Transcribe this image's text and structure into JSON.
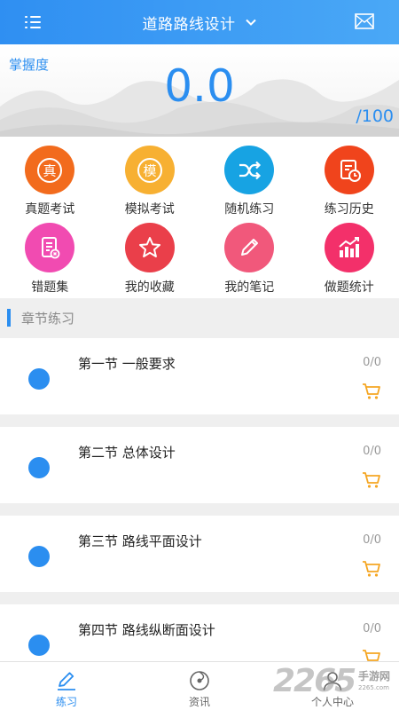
{
  "header": {
    "title": "道路路线设计",
    "menu_icon": "list-menu-icon",
    "mail_icon": "mail-icon",
    "bg": "#3b9bf4"
  },
  "mastery": {
    "label": "掌握度",
    "score": "0.0",
    "total": "/100"
  },
  "features": [
    {
      "label": "真题考试",
      "glyph": "真",
      "color": "#f26b1d",
      "icon": "real-exam-icon"
    },
    {
      "label": "模拟考试",
      "glyph": "模",
      "color": "#f7b032",
      "icon": "mock-exam-icon"
    },
    {
      "label": "随机练习",
      "color": "#17a3e3",
      "icon": "shuffle-icon"
    },
    {
      "label": "练习历史",
      "color": "#f0441c",
      "icon": "history-icon"
    },
    {
      "label": "错题集",
      "color": "#f14bb1",
      "icon": "wrong-questions-icon"
    },
    {
      "label": "我的收藏",
      "color": "#ea3f4a",
      "icon": "star-icon"
    },
    {
      "label": "我的笔记",
      "color": "#f1587b",
      "icon": "pencil-icon"
    },
    {
      "label": "做题统计",
      "color": "#f3306a",
      "icon": "stats-chart-icon"
    }
  ],
  "section": {
    "title": "章节练习"
  },
  "chapters": [
    {
      "name": "第一节 一般要求",
      "count": "0/0"
    },
    {
      "name": "第二节 总体设计",
      "count": "0/0"
    },
    {
      "name": "第三节 路线平面设计",
      "count": "0/0"
    },
    {
      "name": "第四节 路线纵断面设计",
      "count": "0/0"
    }
  ],
  "nav": [
    {
      "label": "练习",
      "icon": "practice-pencil-icon",
      "active": true
    },
    {
      "label": "资讯",
      "icon": "news-icon",
      "active": false
    },
    {
      "label": "个人中心",
      "icon": "user-icon",
      "active": false
    }
  ],
  "watermark": {
    "number": "2265",
    "text": "手游网",
    "url": "2265.com"
  },
  "colors": {
    "accent": "#2b8ef0",
    "cart": "#f5a623"
  }
}
